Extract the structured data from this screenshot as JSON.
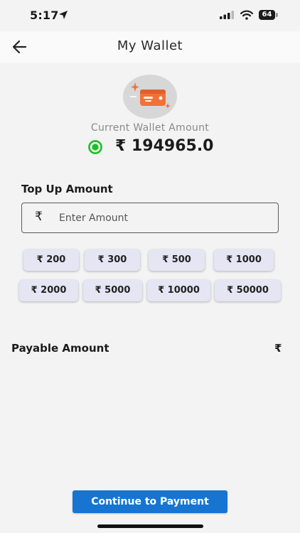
{
  "status_bar": {
    "time": "5:17",
    "battery": "64"
  },
  "header": {
    "title": "My Wallet"
  },
  "wallet": {
    "label": "Current Wallet Amount",
    "balance": "₹ 194965.0"
  },
  "topup": {
    "heading": "Top Up Amount",
    "currency_symbol": "₹",
    "placeholder": "Enter Amount",
    "chips_row1": [
      "₹ 200",
      "₹ 300",
      "₹ 500",
      "₹ 1000"
    ],
    "chips_row2": [
      "₹ 2000",
      "₹ 5000",
      "₹ 10000",
      "₹ 50000"
    ]
  },
  "payable": {
    "label": "Payable Amount",
    "value": "₹"
  },
  "footer": {
    "continue_label": "Continue to Payment"
  },
  "colors": {
    "primary": "#1775d1",
    "status_green": "#1cbf2b",
    "wallet_orange": "#f07238",
    "chip_bg": "#e6e5f4"
  }
}
